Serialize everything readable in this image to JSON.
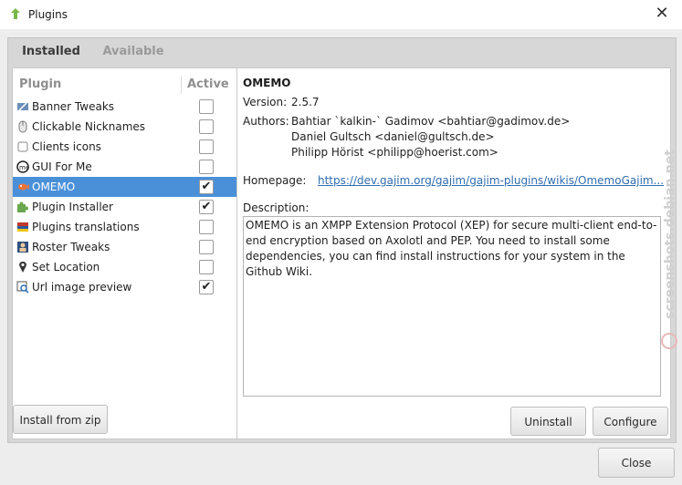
{
  "window": {
    "title": "Plugins",
    "close_glyph": "✕"
  },
  "tabs": [
    {
      "label": "Installed",
      "active": true
    },
    {
      "label": "Available",
      "active": false
    }
  ],
  "list": {
    "col_plugin": "Plugin",
    "col_active": "Active",
    "rows": [
      {
        "label": "Banner Tweaks",
        "icon": "banner-icon",
        "active": false,
        "selected": false
      },
      {
        "label": "Clickable Nicknames",
        "icon": "mouse-icon",
        "active": false,
        "selected": false
      },
      {
        "label": "Clients icons",
        "icon": "clients-icon",
        "active": false,
        "selected": false
      },
      {
        "label": "GUI For Me",
        "icon": "gui-icon",
        "active": false,
        "selected": false
      },
      {
        "label": "OMEMO",
        "icon": "omemo-fish-icon",
        "active": true,
        "selected": true
      },
      {
        "label": "Plugin Installer",
        "icon": "puzzle-icon",
        "active": true,
        "selected": false
      },
      {
        "label": "Plugins translations",
        "icon": "flags-icon",
        "active": false,
        "selected": false
      },
      {
        "label": "Roster Tweaks",
        "icon": "roster-icon",
        "active": false,
        "selected": false
      },
      {
        "label": "Set Location",
        "icon": "location-pin-icon",
        "active": false,
        "selected": false
      },
      {
        "label": "Url image preview",
        "icon": "image-preview-icon",
        "active": true,
        "selected": false
      }
    ]
  },
  "buttons": {
    "install_zip": "Install from zip",
    "uninstall": "Uninstall",
    "configure": "Configure",
    "close": "Close"
  },
  "details": {
    "name": "OMEMO",
    "version_label": "Version:",
    "version": "2.5.7",
    "authors_label": "Authors:",
    "authors": [
      "Bahtiar `kalkin-` Gadimov <bahtiar@gadimov.de>",
      "Daniel Gultsch <daniel@gultsch.de>",
      "Philipp Hörist <philipp@hoerist.com>"
    ],
    "homepage_label": "Homepage:",
    "homepage": "https://dev.gajim.org/gajim/gajim-plugins/wikis/OmemoGajim...",
    "description_label": "Description:",
    "description": "OMEMO is an XMPP Extension Protocol (XEP) for secure multi-client end-to-end encryption based on Axolotl and PEP. You need to install some dependencies, you can find install instructions for your system in the Github Wiki."
  },
  "watermark": "screenshots.debian.net",
  "colors": {
    "accent": "#4a90d9",
    "link": "#2f6db0",
    "tab_indicator": "#4a8fd0"
  }
}
